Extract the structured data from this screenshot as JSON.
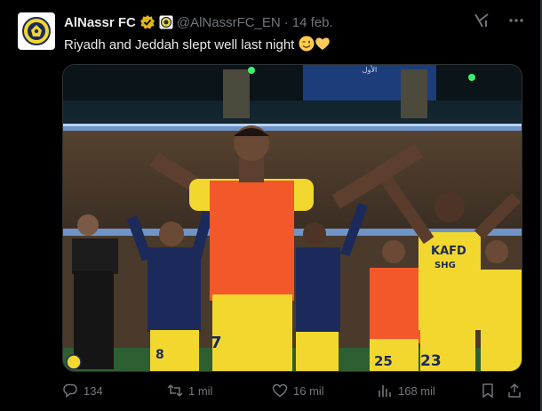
{
  "author": {
    "name": "AlNassr FC",
    "handle": "@AlNassrFC_EN",
    "separator": "·",
    "date": "14 feb."
  },
  "tweet": {
    "text": "Riyadh and Jeddah slept well last night",
    "emoji": [
      "winking-face",
      "yellow-heart"
    ]
  },
  "media": {
    "jersey_sponsor": "KAFD",
    "jersey_sponsor2": "SHG",
    "jersey_numbers": [
      "7",
      "8",
      "25",
      "23"
    ],
    "stadium_sign": "الأول"
  },
  "stats": {
    "replies": "134",
    "retweets": "1 mil",
    "likes": "16 mil",
    "views": "168 mil"
  },
  "colors": {
    "background": "#000000",
    "text": "#e7e9ea",
    "muted": "#71767b",
    "verified_gold": "#e2b719",
    "jersey_yellow": "#f2d82e",
    "bib_orange": "#f2582a",
    "navy": "#1b2a5a"
  },
  "icons": [
    "grok-icon",
    "more-icon",
    "reply-icon",
    "retweet-icon",
    "like-icon",
    "views-icon",
    "bookmark-icon",
    "share-icon",
    "verified-badge-icon",
    "affiliate-badge-icon"
  ]
}
